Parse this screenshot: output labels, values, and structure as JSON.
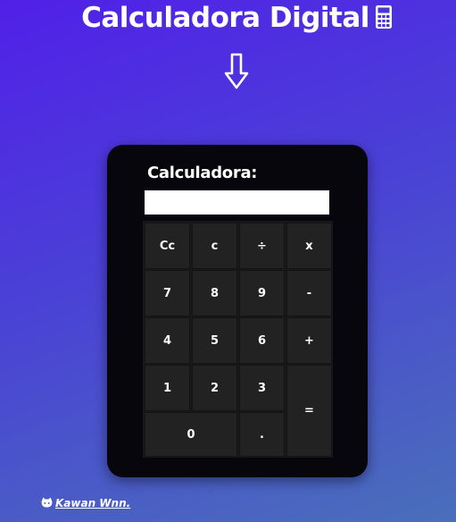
{
  "header": {
    "title": "Calculadora Digital",
    "title_icon": "calculator-icon",
    "arrow_icon": "arrow-down-icon"
  },
  "calculator": {
    "label": "Calculadora:",
    "display_value": "",
    "keys": {
      "clear_all": "Cc",
      "clear": "c",
      "divide": "÷",
      "multiply": "x",
      "seven": "7",
      "eight": "8",
      "nine": "9",
      "minus": "-",
      "four": "4",
      "five": "5",
      "six": "6",
      "plus": "+",
      "one": "1",
      "two": "2",
      "three": "3",
      "equals": "=",
      "zero": "0",
      "dot": "."
    }
  },
  "footer": {
    "credit": "Kawan Wnn.",
    "credit_icon": "github-icon"
  },
  "colors": {
    "background_top": "#5120e8",
    "background_bottom": "#4a6fba",
    "calculator_body": "#06060c",
    "key": "#222222",
    "text": "#ffffff"
  }
}
